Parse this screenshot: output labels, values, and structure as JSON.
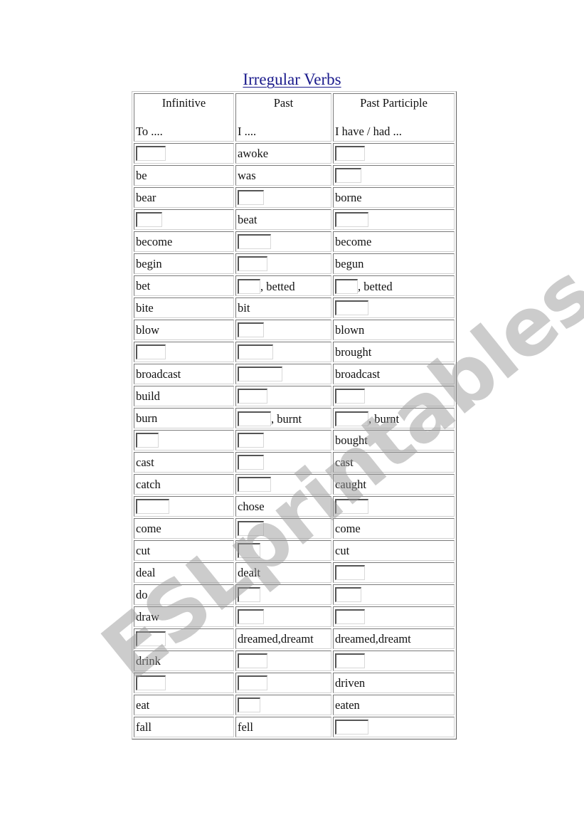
{
  "title": "Irregular Verbs",
  "watermark": "ESLprintables.com",
  "headers": [
    {
      "label": "Infinitive",
      "sub": "To ...."
    },
    {
      "label": "Past",
      "sub": "I ...."
    },
    {
      "label": "Past Participle",
      "sub": "I have / had ..."
    }
  ],
  "rows": [
    {
      "infinitive": "",
      "past": "awoke",
      "participle": ""
    },
    {
      "infinitive": "be",
      "past": "was",
      "participle": ""
    },
    {
      "infinitive": "bear",
      "past": "",
      "participle": "borne"
    },
    {
      "infinitive": "",
      "past": "beat",
      "participle": ""
    },
    {
      "infinitive": "become",
      "past": "",
      "participle": "become"
    },
    {
      "infinitive": "begin",
      "past": "",
      "participle": "begun"
    },
    {
      "infinitive": "bet",
      "past": "",
      "past_suffix": ", betted",
      "participle": "",
      "participle_suffix": ", betted"
    },
    {
      "infinitive": "bite",
      "past": "bit",
      "participle": ""
    },
    {
      "infinitive": "blow",
      "past": "",
      "participle": "blown"
    },
    {
      "infinitive": "",
      "past": "",
      "participle": "brought"
    },
    {
      "infinitive": "broadcast",
      "past": "",
      "participle": "broadcast"
    },
    {
      "infinitive": "build",
      "past": "",
      "participle": ""
    },
    {
      "infinitive": "burn",
      "past": "",
      "past_suffix": ", burnt",
      "participle": "",
      "participle_suffix": ", burnt"
    },
    {
      "infinitive": "",
      "past": "",
      "participle": "bought"
    },
    {
      "infinitive": "cast",
      "past": "",
      "participle": "cast"
    },
    {
      "infinitive": "catch",
      "past": "",
      "participle": "caught"
    },
    {
      "infinitive": "",
      "past": "chose",
      "participle": ""
    },
    {
      "infinitive": "come",
      "past": "",
      "participle": "come"
    },
    {
      "infinitive": "cut",
      "past": "",
      "participle": "cut"
    },
    {
      "infinitive": "deal",
      "past": "dealt",
      "participle": ""
    },
    {
      "infinitive": "do",
      "past": "",
      "participle": ""
    },
    {
      "infinitive": "draw",
      "past": "",
      "participle": ""
    },
    {
      "infinitive": "",
      "past": "dreamed,dreamt",
      "participle": "dreamed,dreamt"
    },
    {
      "infinitive": "drink",
      "past": "",
      "participle": ""
    },
    {
      "infinitive": "",
      "past": "",
      "participle": "driven"
    },
    {
      "infinitive": "eat",
      "past": "",
      "participle": "eaten"
    },
    {
      "infinitive": "fall",
      "past": "fell",
      "participle": ""
    }
  ]
}
